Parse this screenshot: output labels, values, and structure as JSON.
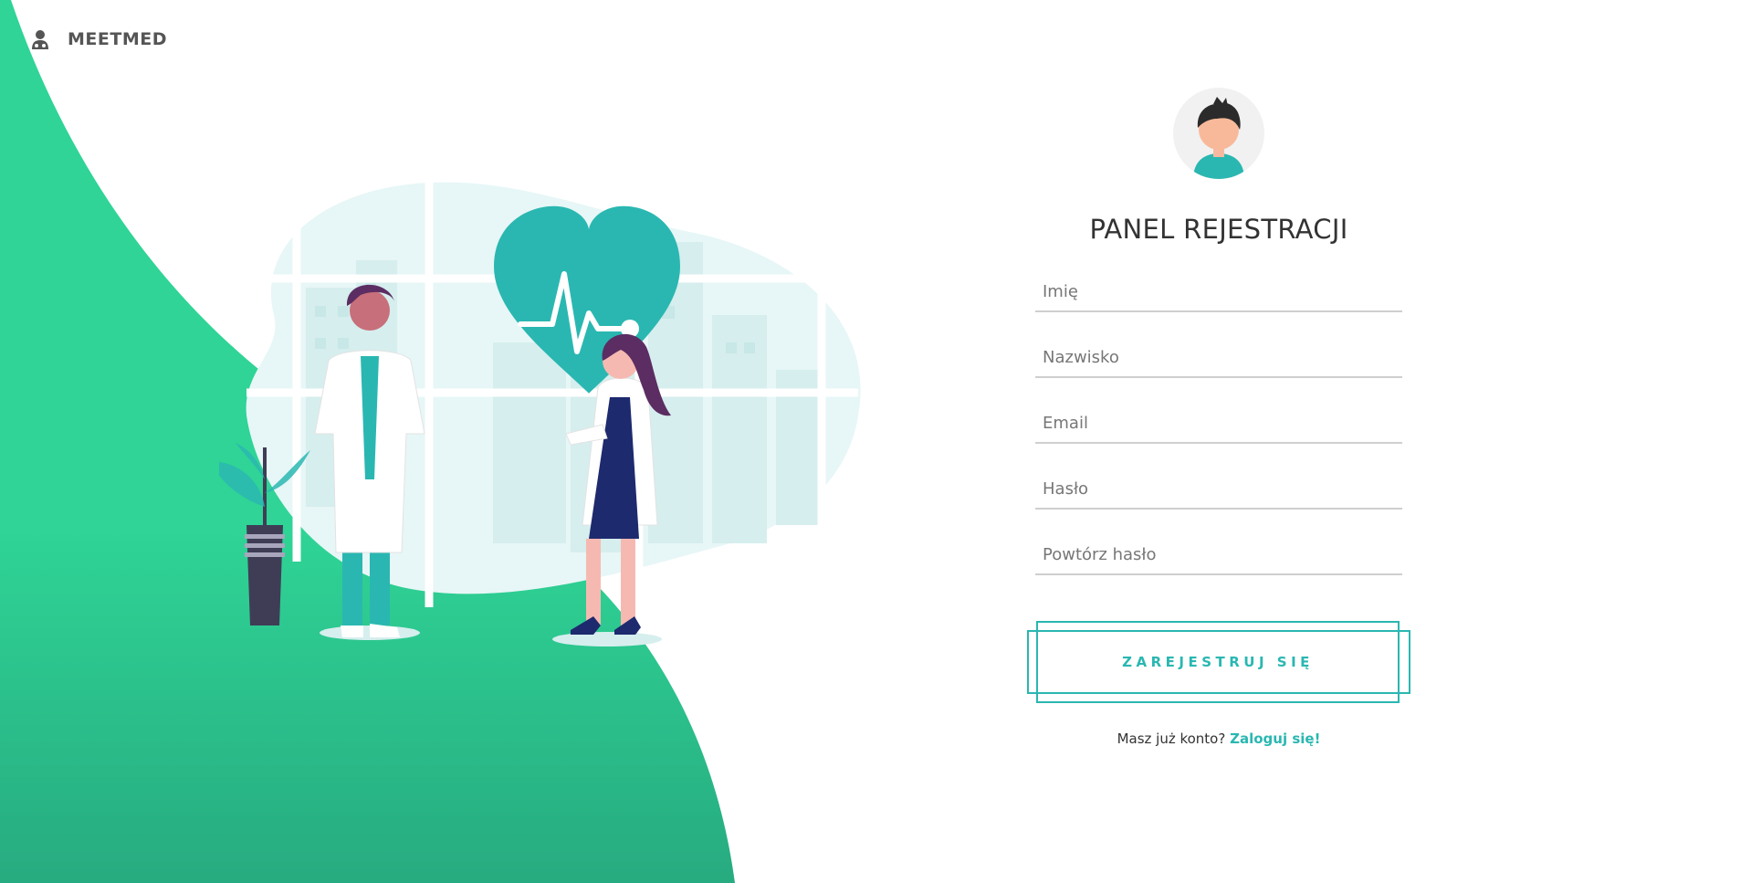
{
  "brand": {
    "name": "MEETMED",
    "icon": "doctor-icon"
  },
  "colors": {
    "accent": "#2ab7b1",
    "green": "#2fd496",
    "green_dark": "#25a47a",
    "heart": "#2ab7b1"
  },
  "form": {
    "title": "PANEL REJESTRACJI",
    "fields": {
      "first_name": {
        "placeholder": "Imię",
        "value": ""
      },
      "last_name": {
        "placeholder": "Nazwisko",
        "value": ""
      },
      "email": {
        "placeholder": "Email",
        "value": ""
      },
      "password": {
        "placeholder": "Hasło",
        "value": ""
      },
      "repeat_password": {
        "placeholder": "Powtórz hasło",
        "value": ""
      }
    },
    "submit_label": "ZAREJESTRUJ SIĘ",
    "login_prompt": "Masz już konto?",
    "login_link": "Zaloguj się!"
  }
}
